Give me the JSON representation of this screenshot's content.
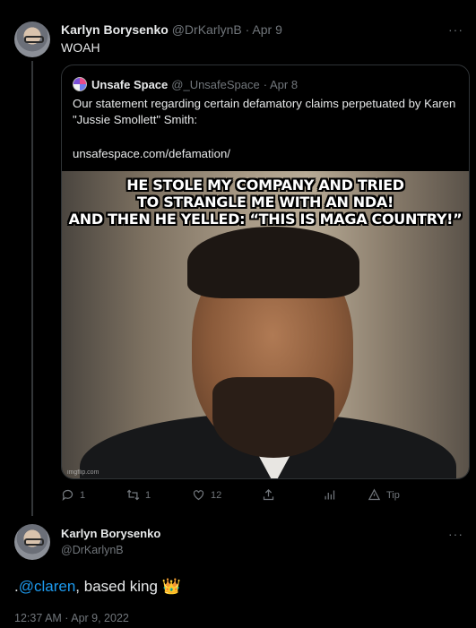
{
  "tweet1": {
    "author_name": "Karlyn Borysenko",
    "author_handle": "@DrKarlynB",
    "date": "· Apr 9",
    "text": "WOAH",
    "more": "···"
  },
  "quote": {
    "author_name": "Unsafe Space",
    "author_handle": "@_UnsafeSpace",
    "date": "· Apr 8",
    "text": "Our statement regarding certain defamatory claims perpetuated by Karen \"Jussie Smollett\" Smith:",
    "link": "unsafespace.com/defamation/",
    "meme": {
      "line1": "HE STOLE MY COMPANY AND TRIED",
      "line2": "TO STRANGLE ME WITH AN NDA!",
      "line3": "AND THEN HE YELLED: “THIS IS MAGA COUNTRY!”",
      "watermark": "imgflip.com"
    }
  },
  "actions": {
    "reply_count": "1",
    "retweet_count": "1",
    "like_count": "12",
    "tip_label": "Tip"
  },
  "tweet2": {
    "author_name": "Karlyn Borysenko",
    "author_handle": "@DrKarlynB",
    "more": "···",
    "text_prefix": ".",
    "mention": "@claren",
    "text_rest": ", based king ",
    "crown": "👑",
    "timestamp": "12:37 AM · Apr 9, 2022"
  }
}
